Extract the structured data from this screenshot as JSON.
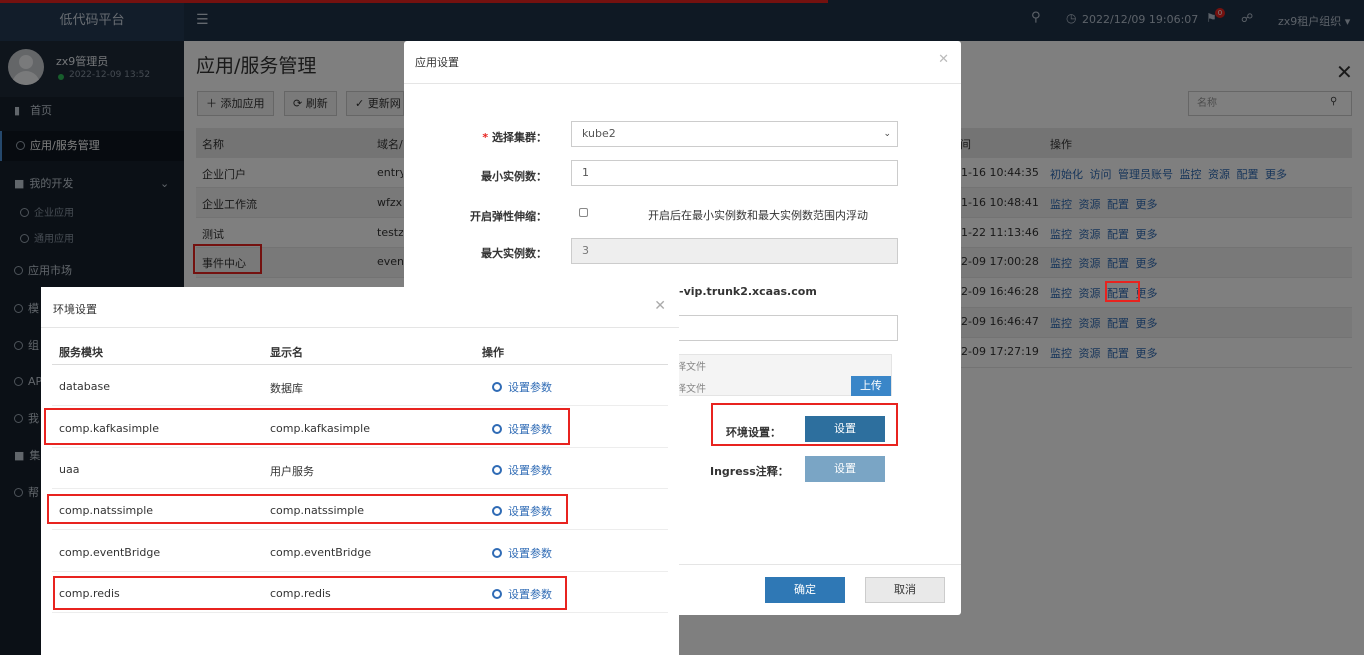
{
  "brand": "低代码平台",
  "topbar": {
    "datetime": "2022/12/09 19:06:07",
    "badge": "0",
    "tenant": "zx9租户组织"
  },
  "user": {
    "name": "zx9管理员",
    "time": "2022-12-09 13:52"
  },
  "sidebar": {
    "items": [
      {
        "label": "首页"
      },
      {
        "label": "应用/服务管理"
      },
      {
        "label": "我的开发"
      },
      {
        "label": "企业应用"
      },
      {
        "label": "通用应用"
      },
      {
        "label": "应用市场"
      },
      {
        "label": "模"
      },
      {
        "label": "组"
      },
      {
        "label": "AP"
      },
      {
        "label": "我"
      },
      {
        "label": "集"
      },
      {
        "label": "帮"
      }
    ]
  },
  "page": {
    "title": "应用/服务管理",
    "toolbar": {
      "add": "添加应用",
      "refresh": "刷新",
      "update": "更新网"
    },
    "search_placeholder": "名称",
    "table": {
      "headers": {
        "name": "名称",
        "domain": "域名/",
        "time": "间",
        "ops": "操作"
      },
      "rows": [
        {
          "name": "企业门户",
          "domain": "entry",
          "time": "1-16 10:44:35",
          "ops": "初始化 访问 管理员账号 监控 资源 配置 更多"
        },
        {
          "name": "企业工作流",
          "domain": "wfzx",
          "time": "1-16 10:48:41",
          "ops": "监控 资源 配置 更多"
        },
        {
          "name": "测试",
          "domain": "testz",
          "time": "1-22 11:13:46",
          "ops": "监控 资源 配置 更多"
        },
        {
          "name": "事件中心",
          "domain": "event",
          "time": "2-09 17:00:28",
          "ops": "监控 资源 配置 更多"
        },
        {
          "name": "",
          "domain": "",
          "time": "2-09 16:46:28",
          "ops": "监控 资源 配置 更多"
        },
        {
          "name": "",
          "domain": "",
          "time": "2-09 16:46:47",
          "ops": "监控 资源 配置 更多"
        },
        {
          "name": "",
          "domain": "",
          "time": "2-09 17:27:19",
          "ops": "监控 资源 配置 更多"
        }
      ]
    }
  },
  "app_modal": {
    "title": "应用设置",
    "cluster_label": "选择集群：",
    "cluster_value": "kube2",
    "min_label": "最小实例数：",
    "min_value": "1",
    "elastic_label": "开启弹性伸缩：",
    "elastic_hint": "开启后在最小实例数和最大实例数范围内浮动",
    "max_label": "最大实例数：",
    "max_value": "3",
    "domain_text": "-vip.trunk2.xcaas.com",
    "file1": "择文件",
    "file2": "择文件",
    "upload": "上传",
    "env_label": "环境设置：",
    "env_button": "设置",
    "ingress_label": "Ingress注释：",
    "ingress_button": "设置",
    "ok": "确定",
    "cancel": "取消"
  },
  "env_modal": {
    "title": "环境设置",
    "headers": {
      "module": "服务模块",
      "display": "显示名",
      "op": "操作"
    },
    "rows": [
      {
        "module": "database",
        "display": "数据库",
        "op": "设置参数"
      },
      {
        "module": "comp.kafkasimple",
        "display": "comp.kafkasimple",
        "op": "设置参数"
      },
      {
        "module": "uaa",
        "display": "用户服务",
        "op": "设置参数"
      },
      {
        "module": "comp.natssimple",
        "display": "comp.natssimple",
        "op": "设置参数"
      },
      {
        "module": "comp.eventBridge",
        "display": "comp.eventBridge",
        "op": "设置参数"
      },
      {
        "module": "comp.redis",
        "display": "comp.redis",
        "op": "设置参数"
      }
    ]
  }
}
